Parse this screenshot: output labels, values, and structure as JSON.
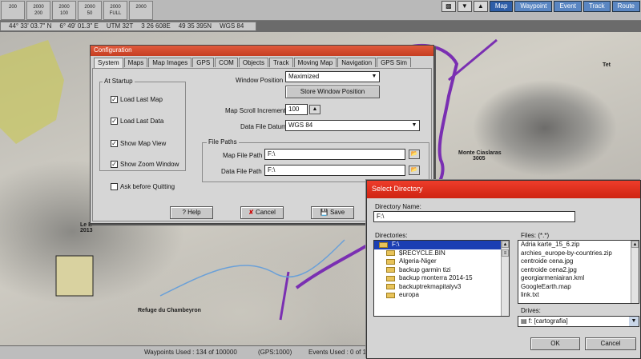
{
  "toolbar": {
    "zoom_buttons": [
      "200",
      "2000",
      "2000",
      "2000",
      "2000",
      "2000"
    ],
    "zoom_sub": [
      "",
      "200",
      "100",
      "50",
      "FULL",
      ""
    ],
    "right_icons": [
      "GPS",
      "Save",
      "Load"
    ],
    "tabs": [
      "Map",
      "Waypoint",
      "Event",
      "Track",
      "Route"
    ]
  },
  "coords": {
    "lat": "44° 33' 03.7\" N",
    "lon": "6° 49' 01.3\" E",
    "utm_zone": "UTM 32T",
    "utm_e": "3 26 608E",
    "utm_n": "49 35 395N",
    "datum": "WGS 84"
  },
  "map": {
    "labels": [
      "Monte Ciaslaras",
      "3005",
      "Refuge du Chambeyron",
      "Le B",
      "2013",
      "Tet"
    ]
  },
  "status": {
    "waypoints": "Waypoints Used : 134 of 100000",
    "gps": "(GPS:1000)",
    "events": "Events Used : 0 of 1000"
  },
  "config": {
    "title": "Configuration",
    "tabs": [
      "System",
      "Maps",
      "Map Images",
      "GPS",
      "COM",
      "Objects",
      "Track",
      "Moving Map",
      "Navigation",
      "GPS Sim"
    ],
    "at_startup_label": "At Startup",
    "checks": [
      {
        "label": "Load Last Map",
        "checked": true
      },
      {
        "label": "Load Last Data",
        "checked": true
      },
      {
        "label": "Show Map View",
        "checked": true
      },
      {
        "label": "Show Zoom Window",
        "checked": true
      }
    ],
    "ask_quit": {
      "label": "Ask before Quitting",
      "checked": false
    },
    "window_position_label": "Window Position",
    "window_position_value": "Maximized",
    "store_window_position": "Store Window Position",
    "scroll_increment_label": "Map Scroll Increment",
    "scroll_increment_value": "100",
    "datum_label": "Data File Datum",
    "datum_value": "WGS 84",
    "file_paths_label": "File Paths",
    "map_file_path_label": "Map File Path",
    "map_file_path_value": "F:\\",
    "data_file_path_label": "Data File Path",
    "data_file_path_value": "F:\\",
    "help": "Help",
    "cancel": "Cancel",
    "save": "Save"
  },
  "select_directory": {
    "title": "Select Directory",
    "directory_name_label": "Directory Name:",
    "directory_name_value": "F:\\",
    "directories_label": "Directories:",
    "directories": [
      "F:\\",
      "$RECYCLE.BIN",
      "Algeria-Niger",
      "backup garmin tizi",
      "backup monterra 2014-15",
      "backuptrekmapitalyv3",
      "europa"
    ],
    "files_label": "Files: (*.*)",
    "files": [
      "Adria karte_15_6.zip",
      "archies_europe-by-countries.zip",
      "centroide cena.jpg",
      "centroide cena2.jpg",
      "georgiarmeniairan.kml",
      "GoogleEarth.map",
      "link.txt"
    ],
    "drives_label": "Drives:",
    "drive_value": "f: [cartografia]",
    "ok": "OK",
    "cancel": "Cancel"
  }
}
